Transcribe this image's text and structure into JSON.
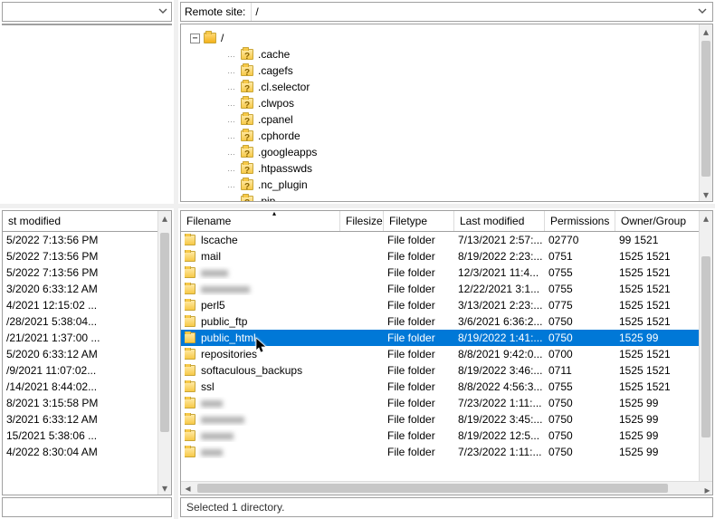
{
  "remote_site_label": "Remote site:",
  "remote_path": "/",
  "tree": {
    "root": "/",
    "items": [
      ".cache",
      ".cagefs",
      ".cl.selector",
      ".clwpos",
      ".cpanel",
      ".cphorde",
      ".googleapps",
      ".htpasswds",
      ".nc_plugin",
      ".pip"
    ]
  },
  "left_header": "st modified",
  "left_rows": [
    "5/2022 7:13:56 PM",
    "5/2022 7:13:56 PM",
    "5/2022 7:13:56 PM",
    "3/2020 6:33:12 AM",
    "4/2021 12:15:02 ...",
    "/28/2021 5:38:04...",
    "/21/2021 1:37:00 ...",
    "5/2020 6:33:12 AM",
    "/9/2021 11:07:02...",
    "/14/2021 8:44:02...",
    "8/2021 3:15:58 PM",
    "3/2021 6:33:12 AM",
    "15/2021 5:38:06 ...",
    "4/2022 8:30:04 AM"
  ],
  "cols": {
    "name": "Filename",
    "size": "Filesize",
    "type": "Filetype",
    "mod": "Last modified",
    "perm": "Permissions",
    "own": "Owner/Group"
  },
  "rows": [
    {
      "name": "lscache",
      "type": "File folder",
      "mod": "7/13/2021 2:57:...",
      "perm": "02770",
      "own": "99 1521",
      "blur": false
    },
    {
      "name": "mail",
      "type": "File folder",
      "mod": "8/19/2022 2:23:...",
      "perm": "0751",
      "own": "1525 1521",
      "blur": false
    },
    {
      "name": "xxxxx",
      "type": "File folder",
      "mod": "12/3/2021 11:4...",
      "perm": "0755",
      "own": "1525 1521",
      "blur": true
    },
    {
      "name": "xxxxxxxxx",
      "type": "File folder",
      "mod": "12/22/2021 3:1...",
      "perm": "0755",
      "own": "1525 1521",
      "blur": true
    },
    {
      "name": "perl5",
      "type": "File folder",
      "mod": "3/13/2021 2:23:...",
      "perm": "0775",
      "own": "1525 1521",
      "blur": false
    },
    {
      "name": "public_ftp",
      "type": "File folder",
      "mod": "3/6/2021 6:36:2...",
      "perm": "0750",
      "own": "1525 1521",
      "blur": false
    },
    {
      "name": "public_html",
      "type": "File folder",
      "mod": "8/19/2022 1:41:...",
      "perm": "0750",
      "own": "1525 99",
      "sel": true,
      "blur": false
    },
    {
      "name": "repositories",
      "type": "File folder",
      "mod": "8/8/2021 9:42:0...",
      "perm": "0700",
      "own": "1525 1521",
      "blur": false
    },
    {
      "name": "softaculous_backups",
      "type": "File folder",
      "mod": "8/19/2022 3:46:...",
      "perm": "0711",
      "own": "1525 1521",
      "blur": false
    },
    {
      "name": "ssl",
      "type": "File folder",
      "mod": "8/8/2022 4:56:3...",
      "perm": "0755",
      "own": "1525 1521",
      "blur": false
    },
    {
      "name": "xxxx",
      "type": "File folder",
      "mod": "7/23/2022 1:11:...",
      "perm": "0750",
      "own": "1525 99",
      "blur": true
    },
    {
      "name": "xxxxxxxx",
      "type": "File folder",
      "mod": "8/19/2022 3:45:...",
      "perm": "0750",
      "own": "1525 99",
      "blur": true
    },
    {
      "name": "xxxxxx",
      "type": "File folder",
      "mod": "8/19/2022 12:5...",
      "perm": "0750",
      "own": "1525 99",
      "blur": true
    },
    {
      "name": "xxxx",
      "type": "File folder",
      "mod": "7/23/2022 1:11:...",
      "perm": "0750",
      "own": "1525 99",
      "blur": true
    }
  ],
  "status": "Selected 1 directory."
}
